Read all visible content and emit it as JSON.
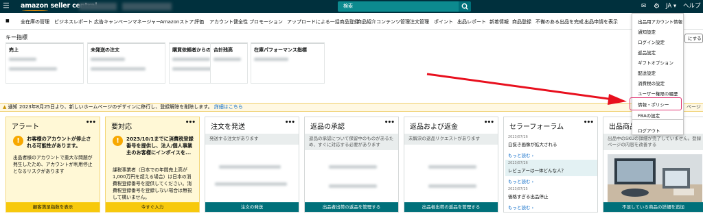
{
  "topbar": {
    "menu_icon": "☰",
    "logo": "amazon seller central",
    "search_placeholder": "検索",
    "right": {
      "mail_icon": "✉",
      "gear_icon": "⚙",
      "lang": "JA ▾",
      "help": "ヘルプ"
    }
  },
  "nav": {
    "bookmark_icon": "■",
    "items": [
      "全在庫の管理",
      "ビジネスレポート",
      "広告キャンペーンマネージャー",
      "Amazonストア",
      "評価",
      "アカウント健全性",
      "プロモーション",
      "アップロードによる一括商品登録",
      "商品紹介コンテンツ管理",
      "注文管理",
      "ポイント",
      "出品レポート",
      "新着情報",
      "商品登録",
      "不備のある出品を完成",
      "出品申請を表示"
    ]
  },
  "key_metrics": {
    "title": "キー指標",
    "items": [
      "売上",
      "未発送の注文",
      "購買依頼者からのメール",
      "合計残高",
      "在庫パフォーマンス指標"
    ]
  },
  "side_button": "にする",
  "notice": {
    "text": "通知 2023年8月25日より、新しいホームページのデザインに移行し、登録解除を削除します。",
    "link": "詳細はこちら",
    "right_text": "ページ"
  },
  "cards": {
    "alert": {
      "title": "アラート",
      "bold": "お客様のアカウントが停止される可能性があります。",
      "body": "出品者様のアカウントで重大な問題が発生したため、アカウントが利用停止となるリスクがあります",
      "button": "顧客満足指数を表示"
    },
    "action": {
      "title": "要対応",
      "bold": "2023/10/1までに消費税登録番号を提供し、法人/個人事業主のお客様にインボイスを...",
      "body": "課税事業者（日本での年間売上高が1,000万円を超える場合）は日本の消費税登録番号を提供してください。消費税登録番号を登録しない場合は無視して構いません。",
      "button": "今すぐ入力"
    },
    "ship": {
      "title": "注文を発送",
      "sub": "発送する注文があります",
      "button": "注文の発送"
    },
    "returns_approve": {
      "title": "返品の承認",
      "sub": "返品の承認について保留中のものがあるため、すぐに対応する必要があります",
      "button": "出品者出荷の返品を管理する"
    },
    "returns_refund": {
      "title": "返品および返金",
      "sub": "未解決の返品リクエストがあります",
      "button": "出品者出荷の返品を管理する"
    },
    "forum": {
      "title": "セラーフォーラム",
      "posts": [
        {
          "date": "2023/07/26",
          "title": "白抜き画像が拡大される",
          "more": "もっと読む ›"
        },
        {
          "date": "2023/07/26",
          "title": "レビュアーは一体どんな人？",
          "more": "もっと読む ›"
        },
        {
          "date": "2023/07/25",
          "title": "価格すぎる出品停止",
          "more": "もっと読む ›"
        }
      ]
    },
    "listing": {
      "title": "出品商品",
      "sub": "出品中のSKUの詳細が完了していません。登録ページの内容を改善する",
      "button": "不足している商品の詳細を追加"
    },
    "dots": "•••"
  },
  "dropdown": {
    "items": [
      "出品用アカウント情報",
      "通知設定",
      "ログイン設定",
      "返品設定",
      "ギフトオプション",
      "配送設定",
      "消費税の設定",
      "ユーザー権限の履歴",
      "情報・ポリシー",
      "FBAの設定",
      "",
      "ログアウト"
    ]
  },
  "colors": {
    "topbar": "#00303d",
    "teal_button": "#00707a",
    "highlight_box": "#e0306f",
    "arrow": "#e8101e"
  }
}
